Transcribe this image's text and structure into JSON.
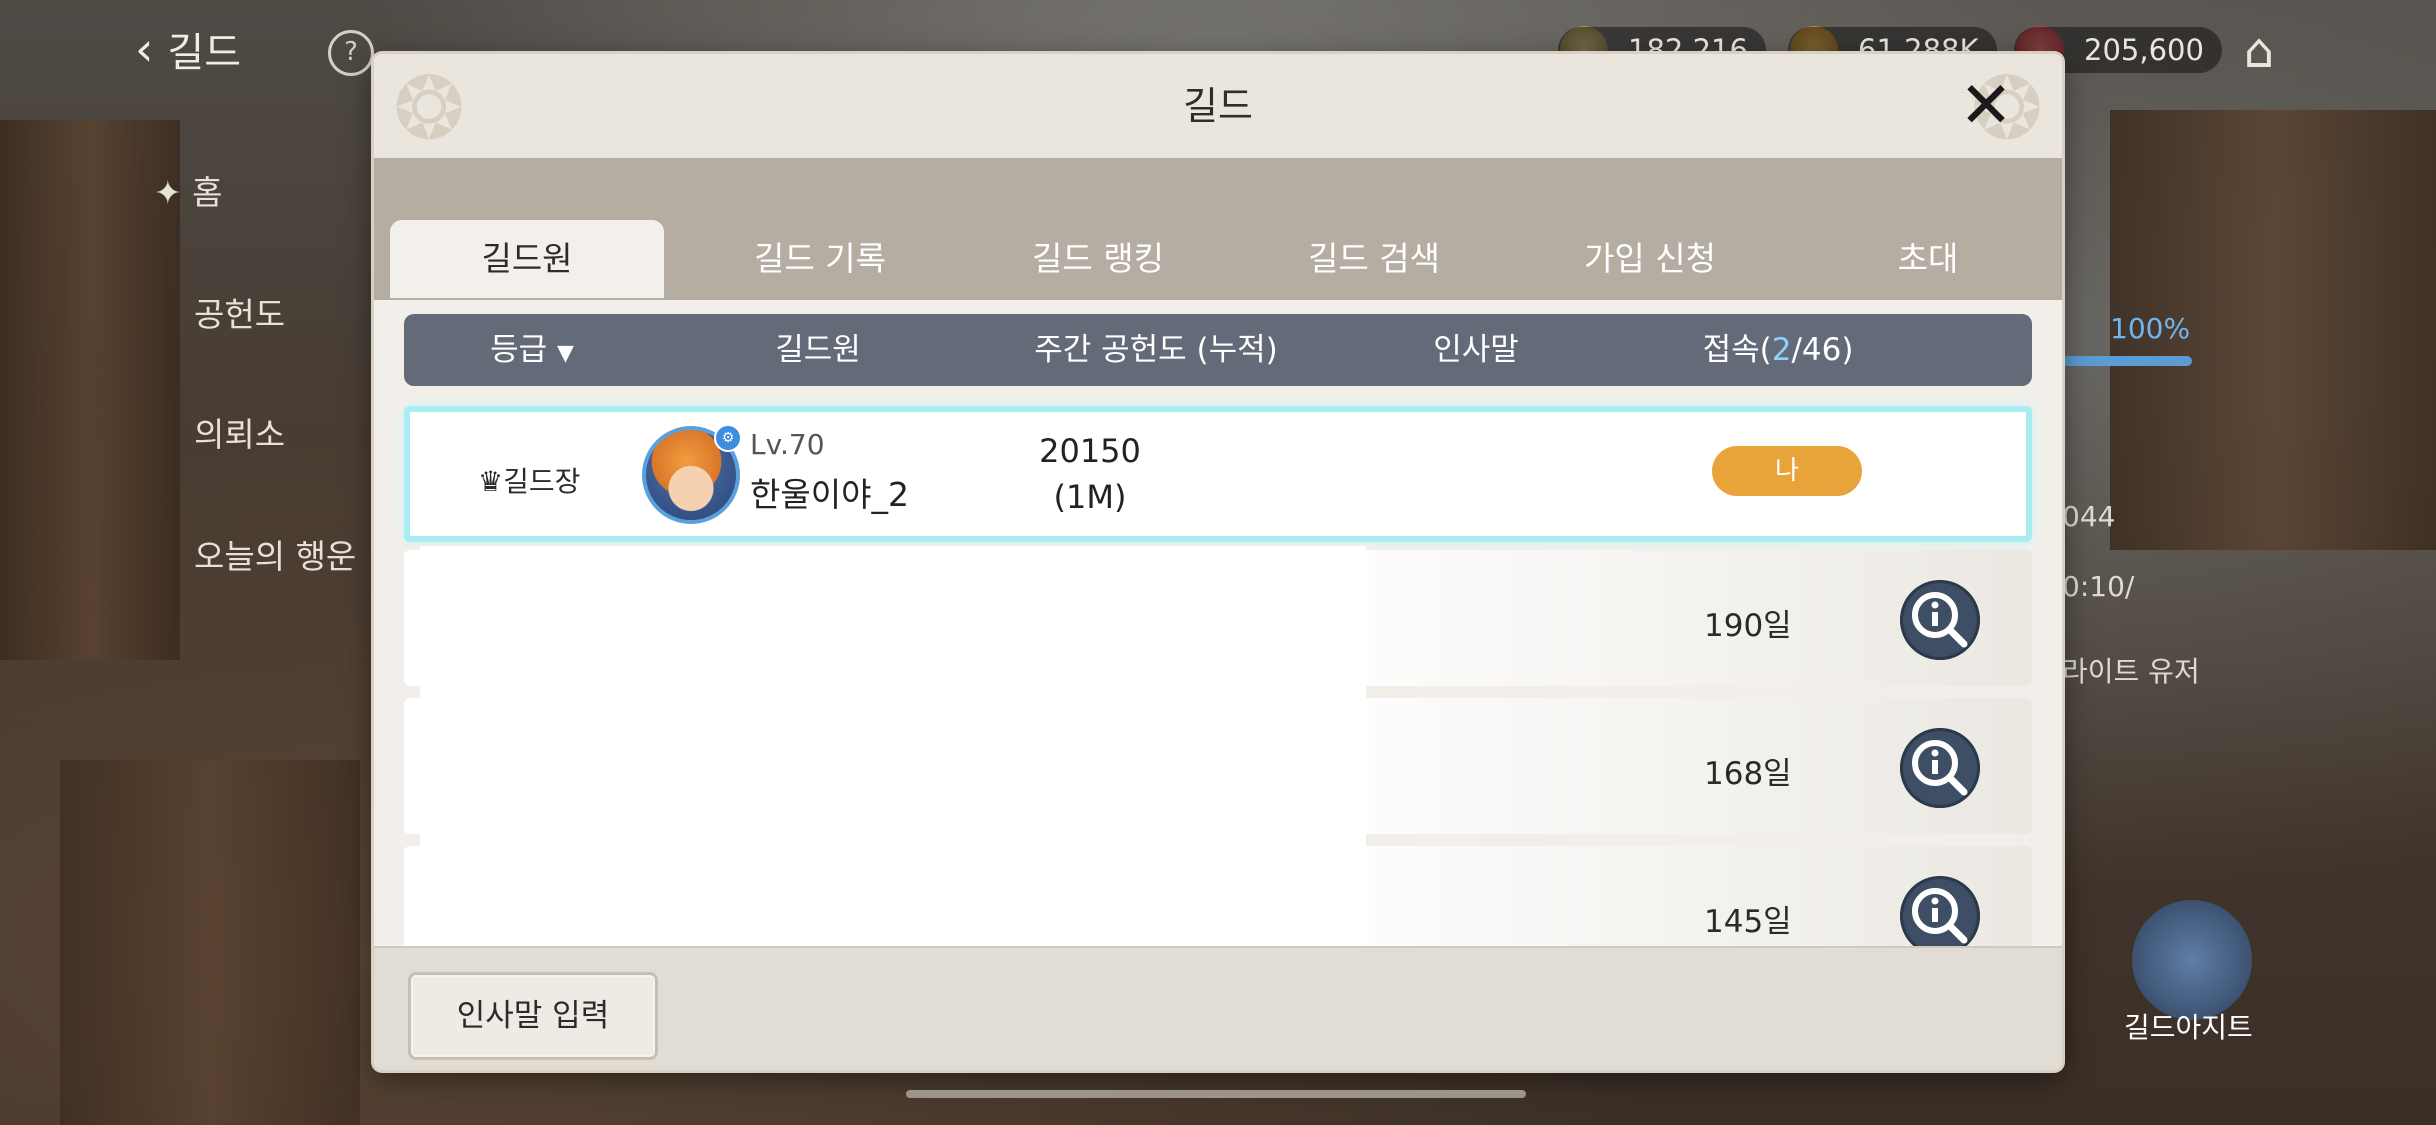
{
  "background": {
    "back_label": "길드",
    "help_icon": "question-icon",
    "currencies": [
      {
        "icon": "gem-icon",
        "value": "182,216"
      },
      {
        "icon": "gold-coin-icon",
        "value": "61,288K"
      },
      {
        "icon": "ruby-icon",
        "value": "205,600"
      }
    ],
    "home_icon": "home-icon",
    "left_menu": [
      "홈",
      "공헌도",
      "의뢰소",
      "오늘의 행운"
    ],
    "right_widget": {
      "percent": "100%",
      "value_text": "044",
      "time_text": "0:10/",
      "light_user_text": "라이트 유저",
      "hideout_label": "길드아지트"
    }
  },
  "modal": {
    "title": "길드",
    "close_icon": "close-icon",
    "tabs": [
      {
        "label": "길드원",
        "active": true
      },
      {
        "label": "길드 기록",
        "active": false
      },
      {
        "label": "길드 랭킹",
        "active": false
      },
      {
        "label": "길드 검색",
        "active": false
      },
      {
        "label": "가입 신청",
        "active": false
      },
      {
        "label": "초대",
        "active": false
      }
    ],
    "table_header": {
      "grade": "등급",
      "grade_sort_icon": "sort-down-icon",
      "member": "길드원",
      "weekly_contribution": "주간 공헌도 (누적)",
      "greeting": "인사말",
      "online_prefix": "접속(",
      "online_count": "2",
      "online_suffix": "/46)"
    },
    "me_row": {
      "rank_icon": "crown-icon",
      "rank": "길드장",
      "level": "Lv.70",
      "name": "한울이야_2",
      "contribution": "20150",
      "contribution_total": "(1M)",
      "status_badge": "나"
    },
    "member_rows": [
      {
        "days": "190일",
        "icon": "info-search-icon"
      },
      {
        "days": "168일",
        "icon": "info-search-icon"
      },
      {
        "days": "145일",
        "icon": "info-search-icon"
      }
    ],
    "footer": {
      "greeting_button": "인사말 입력"
    }
  }
}
